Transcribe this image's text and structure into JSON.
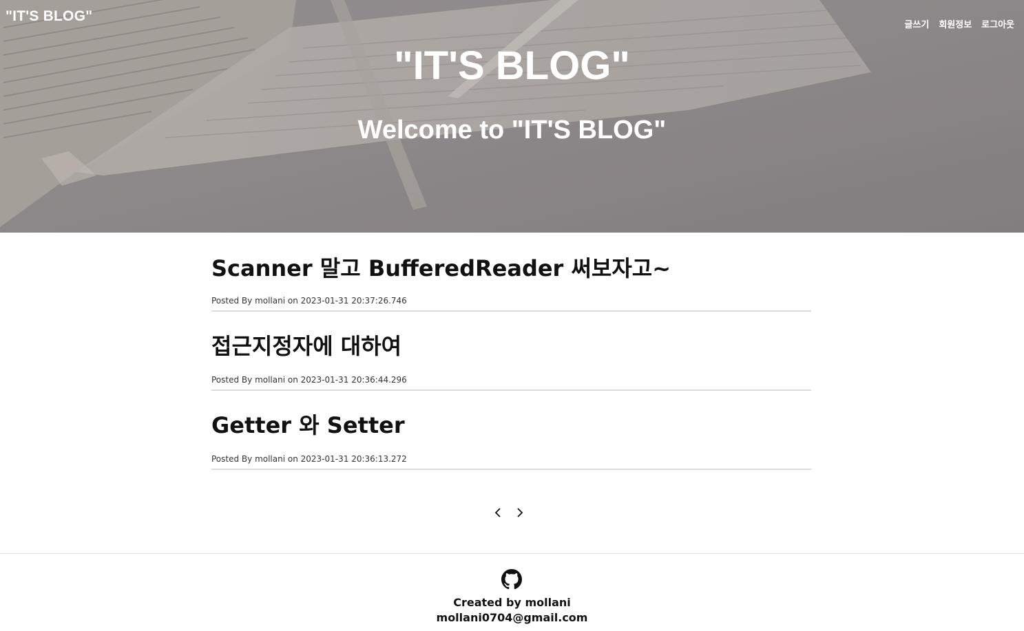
{
  "header": {
    "brand": "\"IT'S BLOG\"",
    "nav": [
      {
        "label": "글쓰기"
      },
      {
        "label": "회원정보"
      },
      {
        "label": "로그아웃"
      }
    ]
  },
  "hero": {
    "title": "\"IT'S BLOG\"",
    "subtitle": "Welcome to \"IT'S BLOG\""
  },
  "posts": [
    {
      "title": "Scanner 말고 BufferedReader 써보자고~",
      "meta": "Posted By mollani on 2023-01-31 20:37:26.746"
    },
    {
      "title": "접근지정자에 대하여",
      "meta": "Posted By mollani on 2023-01-31 20:36:44.296"
    },
    {
      "title": "Getter 와 Setter",
      "meta": "Posted By mollani on 2023-01-31 20:36:13.272"
    }
  ],
  "pager": {
    "prev_icon": "chevron-left-icon",
    "next_icon": "chevron-right-icon"
  },
  "footer": {
    "icon": "github-icon",
    "created": "Created by mollani",
    "email": "mollani0704@gmail.com"
  }
}
